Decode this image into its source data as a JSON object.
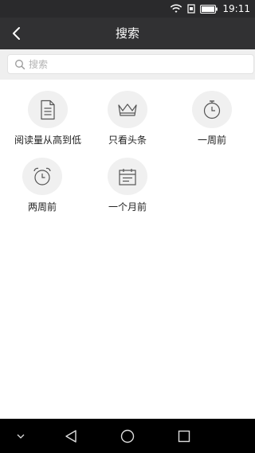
{
  "status": {
    "time": "19:11"
  },
  "appbar": {
    "title": "搜索"
  },
  "search": {
    "placeholder": "搜索"
  },
  "items": [
    {
      "label": "阅读量从高到低",
      "icon": "document-icon"
    },
    {
      "label": "只看头条",
      "icon": "crown-icon"
    },
    {
      "label": "一周前",
      "icon": "stopwatch-icon"
    },
    {
      "label": "两周前",
      "icon": "alarm-clock-icon"
    },
    {
      "label": "一个月前",
      "icon": "calendar-icon"
    }
  ],
  "colors": {
    "appbar": "#313133",
    "statusbar": "#2a2a2c",
    "search_bg": "#efefef",
    "circle": "#f0f0f0",
    "navbar": "#000000"
  }
}
